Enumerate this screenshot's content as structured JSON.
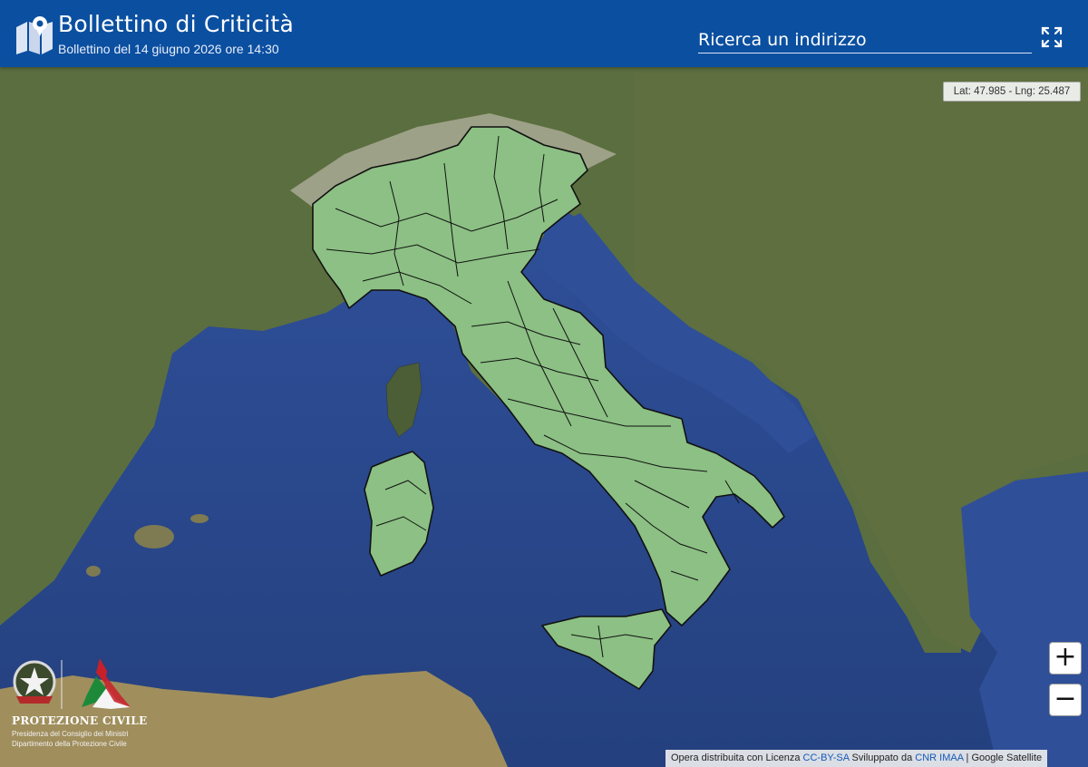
{
  "header": {
    "title": "Bollettino di Criticità",
    "subtitle": "Bollettino del 14 giugno 2026 ore 14:30",
    "search_placeholder": "Ricerca un indirizzo"
  },
  "map": {
    "layer": "Google Satellite",
    "coords_text": "Lat: 47.985 - Lng: 25.487",
    "zone_color": "#8cc084",
    "zone_border_color": "#111111"
  },
  "controls": {
    "zoom_in_label": "+",
    "zoom_out_label": "−"
  },
  "attribution": {
    "prefix": "Opera distribuita con Licenza",
    "license": "CC-BY-SA",
    "developed_by": "Sviluppato da",
    "developer": "CNR IMAA",
    "separator": "|",
    "layer": "Google Satellite"
  },
  "branding": {
    "title": "PROTEZIONE CIVILE",
    "line1": "Presidenza del Consiglio dei Ministri",
    "line2": "Dipartimento della Protezione Civile"
  }
}
